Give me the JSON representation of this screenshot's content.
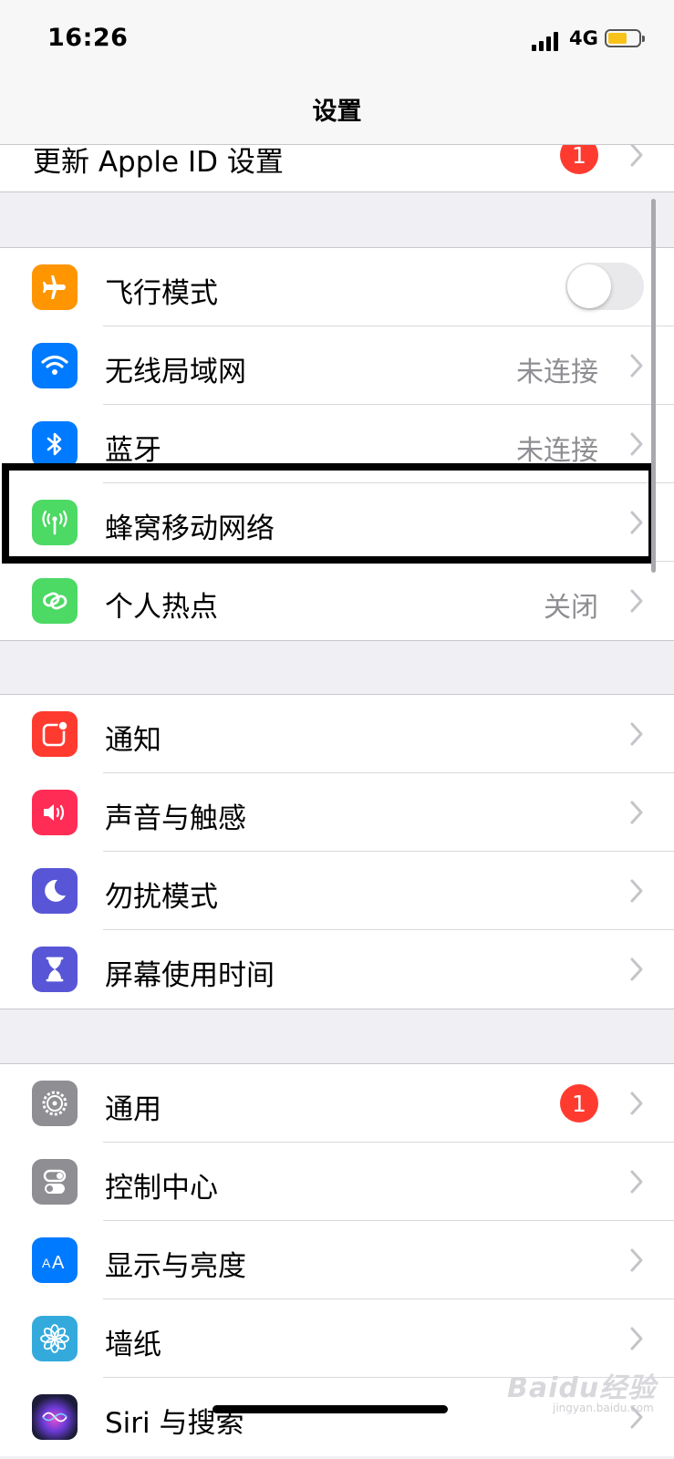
{
  "status_bar": {
    "time": "16:26",
    "network": "4G",
    "battery_color": "#f7c31a"
  },
  "nav": {
    "title": "设置"
  },
  "top_group": [
    {
      "label": "更新 Apple ID 设置",
      "badge": "1"
    }
  ],
  "group1": [
    {
      "label": "飞行模式",
      "icon": "airplane-icon",
      "icon_color": "#ff9500",
      "toggle_on": false
    },
    {
      "label": "无线局域网",
      "icon": "wifi-icon",
      "icon_color": "#007aff",
      "value": "未连接"
    },
    {
      "label": "蓝牙",
      "icon": "bluetooth-icon",
      "icon_color": "#007aff",
      "value": "未连接"
    },
    {
      "label": "蜂窝移动网络",
      "icon": "cellular-antenna-icon",
      "icon_color": "#4cd964"
    },
    {
      "label": "个人热点",
      "icon": "hotspot-icon",
      "icon_color": "#4cd964",
      "value": "关闭"
    }
  ],
  "group2": [
    {
      "label": "通知",
      "icon": "notifications-icon",
      "icon_color": "#ff3b30"
    },
    {
      "label": "声音与触感",
      "icon": "speaker-icon",
      "icon_color": "#ff2d55"
    },
    {
      "label": "勿扰模式",
      "icon": "moon-icon",
      "icon_color": "#5856d6"
    },
    {
      "label": "屏幕使用时间",
      "icon": "hourglass-icon",
      "icon_color": "#5856d6"
    }
  ],
  "group3": [
    {
      "label": "通用",
      "icon": "gear-icon",
      "icon_color": "#8e8e93",
      "badge": "1"
    },
    {
      "label": "控制中心",
      "icon": "toggles-icon",
      "icon_color": "#8e8e93"
    },
    {
      "label": "显示与亮度",
      "icon": "text-size-icon",
      "icon_color": "#007aff"
    },
    {
      "label": "墙纸",
      "icon": "flower-icon",
      "icon_color": "#34aadc"
    },
    {
      "label": "Siri 与搜索",
      "icon": "siri-icon",
      "icon_color": "#1c1c3a"
    }
  ],
  "watermark": {
    "text": "Baidu经验",
    "sub": "jingyan.baidu.com"
  }
}
